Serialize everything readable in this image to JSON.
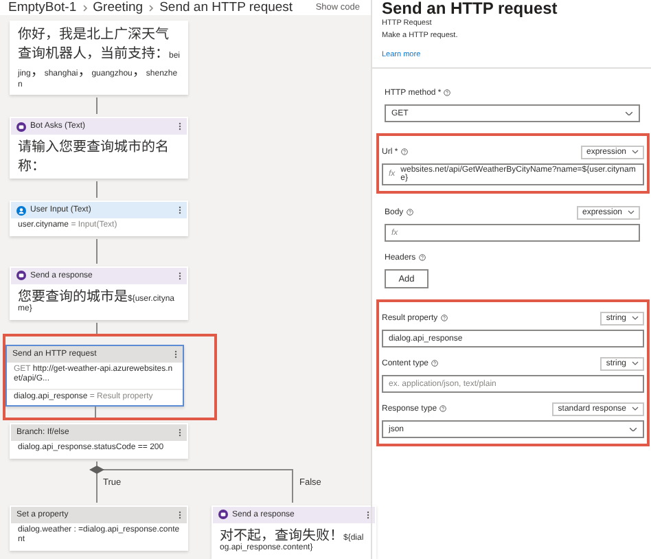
{
  "breadcrumb": [
    {
      "label": "EmptyBot-1"
    },
    {
      "label": "Greeting"
    },
    {
      "label": "Send an HTTP request"
    }
  ],
  "show_code": "Show code",
  "flow": {
    "nodes": [
      {
        "kind": "message",
        "selected": false,
        "highlighted": false,
        "lines": [
          {
            "text": "你好，我是北上广深天气查询机器人，当前支持：beijing，shanghai，guangzhou，shenzhen"
          }
        ]
      },
      {
        "kind": "bot",
        "title": "Bot Asks (Text)",
        "selected": false,
        "highlighted": false,
        "lines": [
          {
            "text": "请输入您要查询城市的名称："
          }
        ]
      },
      {
        "kind": "user",
        "title": "User Input (Text)",
        "selected": false,
        "highlighted": false,
        "lines": [
          {
            "text": "user.cityname",
            "note": "= Input(Text)"
          }
        ]
      },
      {
        "kind": "bot",
        "title": "Send a response",
        "selected": false,
        "highlighted": false,
        "lines": [
          {
            "text": "您要查询的城市是${user.cityname}"
          }
        ]
      },
      {
        "kind": "plain",
        "title": "Send an HTTP request",
        "selected": true,
        "highlighted": true,
        "lines": [
          {
            "lead": "GET",
            "text": "http://get-weather-api.azurewebsites.net/api/G..."
          },
          {
            "text": "dialog.api_response",
            "note": "= Result property"
          }
        ]
      },
      {
        "kind": "plain",
        "title": "Branch: If/else",
        "selected": false,
        "highlighted": false,
        "lines": [
          {
            "text": "dialog.api_response.statusCode == 200"
          }
        ]
      }
    ],
    "branches": [
      {
        "label": "True",
        "nodes": [
          {
            "kind": "plain",
            "title": "Set a property",
            "selected": false,
            "highlighted": false,
            "lines": [
              {
                "text": "dialog.weather : =dialog.api_response.content"
              }
            ]
          }
        ]
      },
      {
        "label": "False",
        "nodes": [
          {
            "kind": "bot",
            "title": "Send a response",
            "selected": false,
            "highlighted": false,
            "lines": [
              {
                "text": "对不起，查询失败！${dialog.api_response.content}"
              }
            ]
          }
        ]
      }
    ]
  },
  "panel": {
    "title": "Send an HTTP request",
    "subtitle": "HTTP Request",
    "description": "Make a HTTP request.",
    "link": "Learn more",
    "sections": [
      {
        "highlighted": false,
        "fields": [
          {
            "kind": "select",
            "label": "HTTP method *",
            "value": "GET"
          }
        ]
      },
      {
        "highlighted": true,
        "fields": [
          {
            "kind": "expression",
            "label": "Url *",
            "mode": "expression",
            "prefix": "fx",
            "value": "websites.net/api/GetWeatherByCityName?name=${user.cityname}"
          }
        ]
      },
      {
        "highlighted": false,
        "fields": [
          {
            "kind": "expression",
            "label": "Body",
            "mode": "expression",
            "prefix": "fx"
          },
          {
            "kind": "button",
            "label": "Headers",
            "button": "Add"
          }
        ]
      },
      {
        "highlighted": true,
        "fields": [
          {
            "kind": "text",
            "label": "Result property",
            "mode": "string",
            "value": "dialog.api_response"
          },
          {
            "kind": "text",
            "label": "Content type",
            "mode": "string",
            "placeholder": "ex. application/json, text/plain"
          },
          {
            "kind": "select",
            "label": "Response type",
            "mode": "standard response",
            "value": "json"
          }
        ]
      }
    ]
  }
}
